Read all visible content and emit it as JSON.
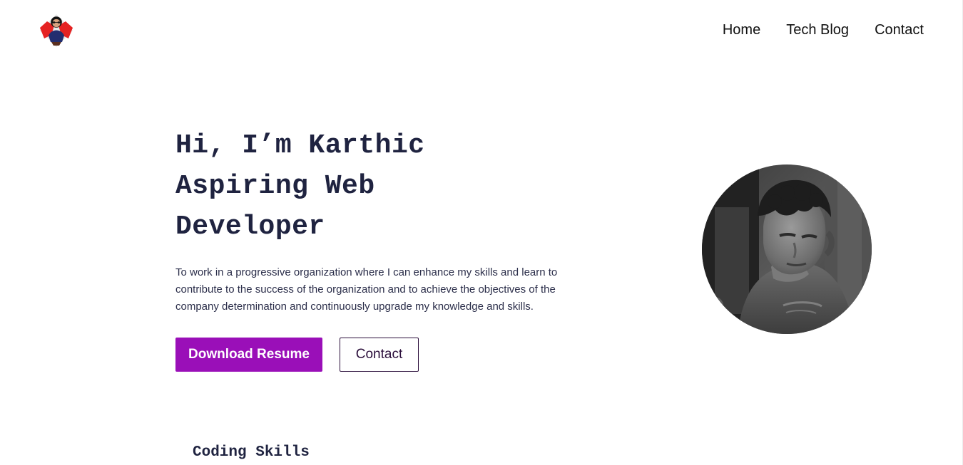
{
  "header": {
    "logo_icon": "profile-logo-icon",
    "nav": [
      {
        "label": "Home"
      },
      {
        "label": "Tech Blog"
      },
      {
        "label": "Contact"
      }
    ]
  },
  "hero": {
    "title_lines": [
      "Hi, I’m Karthic",
      "Aspiring Web",
      "Developer"
    ],
    "description": "To work in a progressive organization where I can enhance my skills and learn to contribute to the success of the organization and to achieve the objectives of the company determination and continuously upgrade my knowledge and skills.",
    "primary_button": "Download Resume",
    "secondary_button": "Contact",
    "avatar_icon": "profile-photo"
  },
  "sections": {
    "coding_skills_title": "Coding Skills"
  },
  "colors": {
    "primary": "#9a0fb8",
    "text_dark": "#1f2340",
    "outline": "#2a0d3a"
  }
}
